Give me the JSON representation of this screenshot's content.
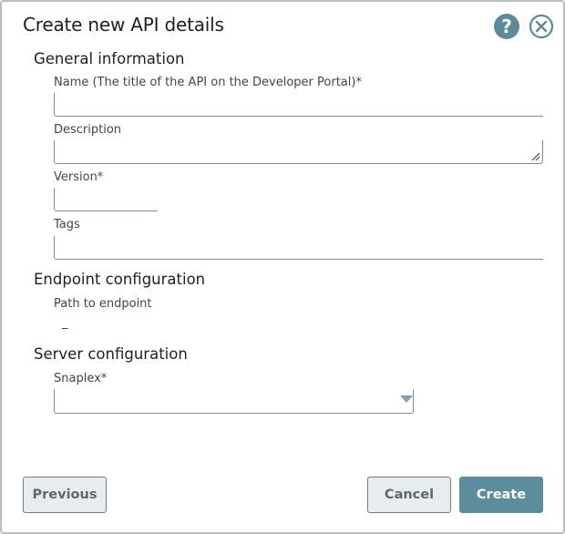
{
  "dialog": {
    "title": "Create new API details",
    "help_icon_glyph": "?",
    "close_icon": "close-circle-icon"
  },
  "sections": {
    "general": {
      "title": "General information",
      "name_label": "Name (The title of the API on the Developer Portal)*",
      "name_value": "",
      "description_label": "Description",
      "description_value": "",
      "version_label": "Version*",
      "version_value": "",
      "tags_label": "Tags",
      "tags_value": ""
    },
    "endpoint": {
      "title": "Endpoint configuration",
      "path_label": "Path to endpoint",
      "path_value": "_"
    },
    "server": {
      "title": "Server configuration",
      "snaplex_label": "Snaplex*",
      "snaplex_value": ""
    }
  },
  "buttons": {
    "previous": "Previous",
    "cancel": "Cancel",
    "create": "Create"
  },
  "colors": {
    "accent": "#5b8d9c",
    "border": "#7a8e96"
  }
}
